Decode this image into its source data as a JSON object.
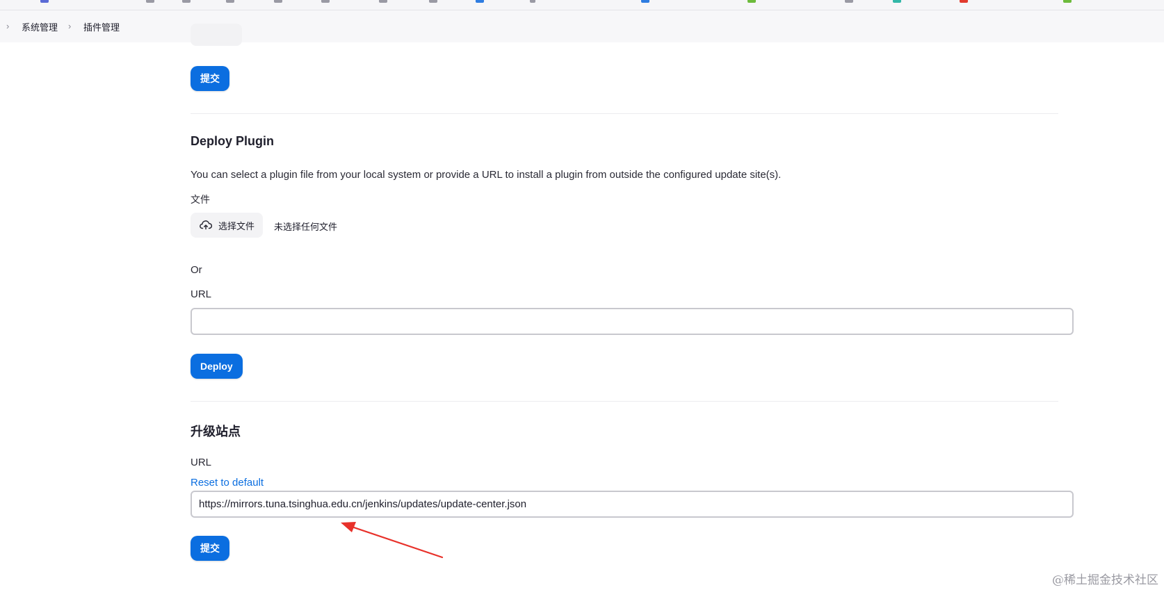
{
  "breadcrumb": {
    "items": [
      {
        "label": "系统管理"
      },
      {
        "label": "插件管理"
      }
    ]
  },
  "top_form": {
    "submit_label": "提交"
  },
  "deploy_plugin": {
    "title": "Deploy Plugin",
    "description": "You can select a plugin file from your local system or provide a URL to install a plugin from outside the configured update site(s).",
    "file_label": "文件",
    "choose_file_label": "选择文件",
    "file_status": "未选择任何文件",
    "or_label": "Or",
    "url_label": "URL",
    "url_value": "",
    "deploy_label": "Deploy"
  },
  "update_site": {
    "title": "升级站点",
    "url_label": "URL",
    "reset_label": "Reset to default",
    "url_value": "https://mirrors.tuna.tsinghua.edu.cn/jenkins/updates/update-center.json",
    "submit_label": "提交"
  },
  "annotation": {
    "arrow_color": "#e8312a"
  },
  "colors": {
    "accent": "#0b6ee0",
    "link": "#0b6ee0"
  },
  "watermark": "@稀土掘金技术社区",
  "icons": {
    "upload": "cloud-upload-icon",
    "breadcrumb_separator": "chevron-right-icon"
  }
}
